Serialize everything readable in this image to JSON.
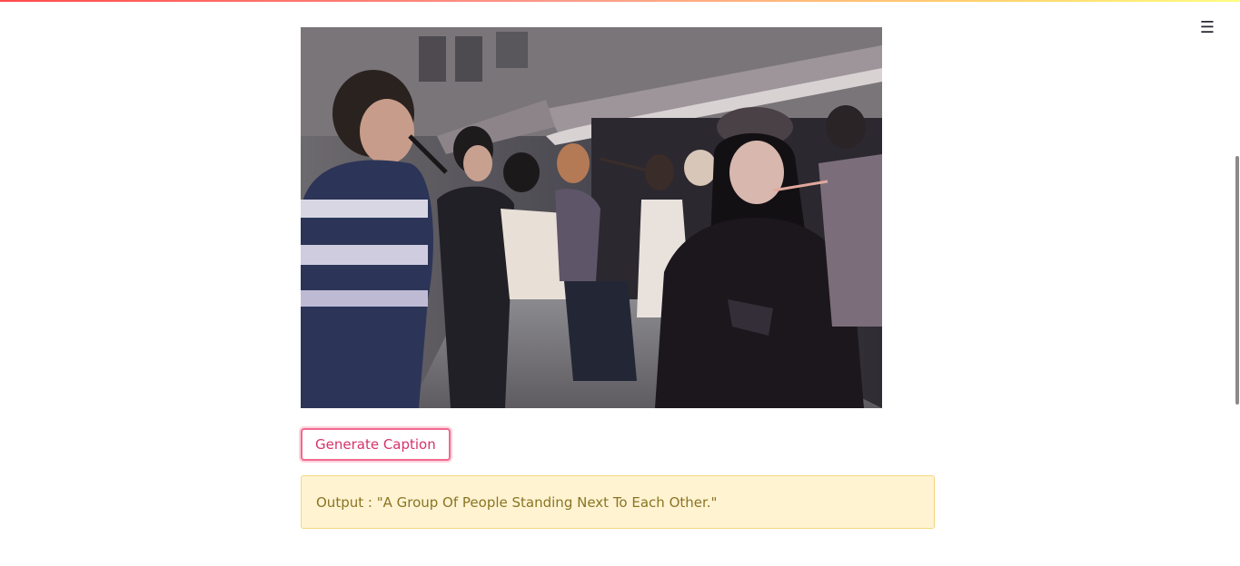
{
  "app": {
    "menu_icon": "hamburger-menu-icon"
  },
  "image": {
    "alt": "A Group Of People Standing Next To Each Other"
  },
  "actions": {
    "generate_label": "Generate Caption"
  },
  "output": {
    "text": "Output : \"A Group Of People Standing Next To Each Other.\""
  },
  "colors": {
    "accent": "#f06a8f",
    "button_text": "#d6336c",
    "output_bg": "#fff3d2",
    "output_border": "#f3d77e",
    "output_text": "#8a7422"
  }
}
